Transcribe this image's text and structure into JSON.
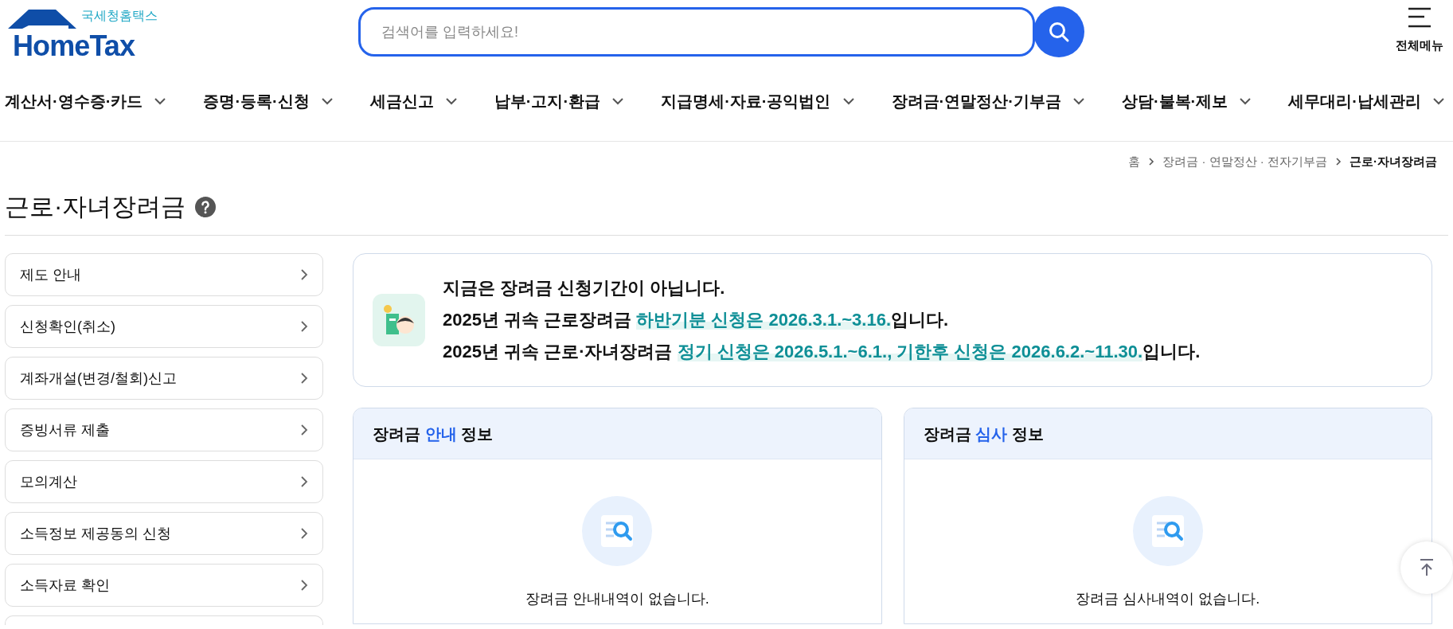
{
  "logo": {
    "subtitle": "국세청홈택스",
    "name": "HomeTax"
  },
  "search": {
    "placeholder": "검색어를 입력하세요!"
  },
  "all_menu": {
    "label": "전체메뉴"
  },
  "nav": [
    "계산서·영수증·카드",
    "증명·등록·신청",
    "세금신고",
    "납부·고지·환급",
    "지급명세·자료·공익법인",
    "장려금·연말정산·기부금",
    "상담·불복·제보",
    "세무대리·납세관리"
  ],
  "breadcrumb": [
    {
      "label": "홈",
      "current": false
    },
    {
      "label": "장려금 · 연말정산 · 전자기부금",
      "current": false
    },
    {
      "label": "근로·자녀장려금",
      "current": true
    }
  ],
  "page_title": "근로·자녀장려금",
  "sidebar": {
    "items": [
      {
        "label": "제도 안내"
      },
      {
        "label": "신청확인(취소)"
      },
      {
        "label": "계좌개설(변경/철회)신고"
      },
      {
        "label": "증빙서류 제출"
      },
      {
        "label": "모의계산"
      },
      {
        "label": "소득정보 제공동의 신청"
      },
      {
        "label": "소득자료 확인"
      }
    ]
  },
  "notice": {
    "lines": [
      [
        {
          "text": "지금은 장려금 신청기간이 아닙니다.",
          "highlight": false
        }
      ],
      [
        {
          "text": "2025년 귀속 근로장려금 ",
          "highlight": false
        },
        {
          "text": "하반기분 신청은 2026.3.1.~3.16.",
          "highlight": true
        },
        {
          "text": "입니다.",
          "highlight": false
        }
      ],
      [
        {
          "text": "2025년 귀속 근로·자녀장려금 ",
          "highlight": false
        },
        {
          "text": "정기 신청은 2026.5.1.~6.1., 기한후 신청은 2026.6.2.~11.30.",
          "highlight": true
        },
        {
          "text": "입니다.",
          "highlight": false
        }
      ]
    ]
  },
  "cards": [
    {
      "title": [
        {
          "text": "장려금 ",
          "accent": false
        },
        {
          "text": "안내",
          "accent": true
        },
        {
          "text": " 정보",
          "accent": false
        }
      ],
      "empty_message": "장려금 안내내역이 없습니다."
    },
    {
      "title": [
        {
          "text": "장려금 ",
          "accent": false
        },
        {
          "text": "심사",
          "accent": true
        },
        {
          "text": " 정보",
          "accent": false
        }
      ],
      "empty_message": "장려금 심사내역이 없습니다."
    }
  ]
}
